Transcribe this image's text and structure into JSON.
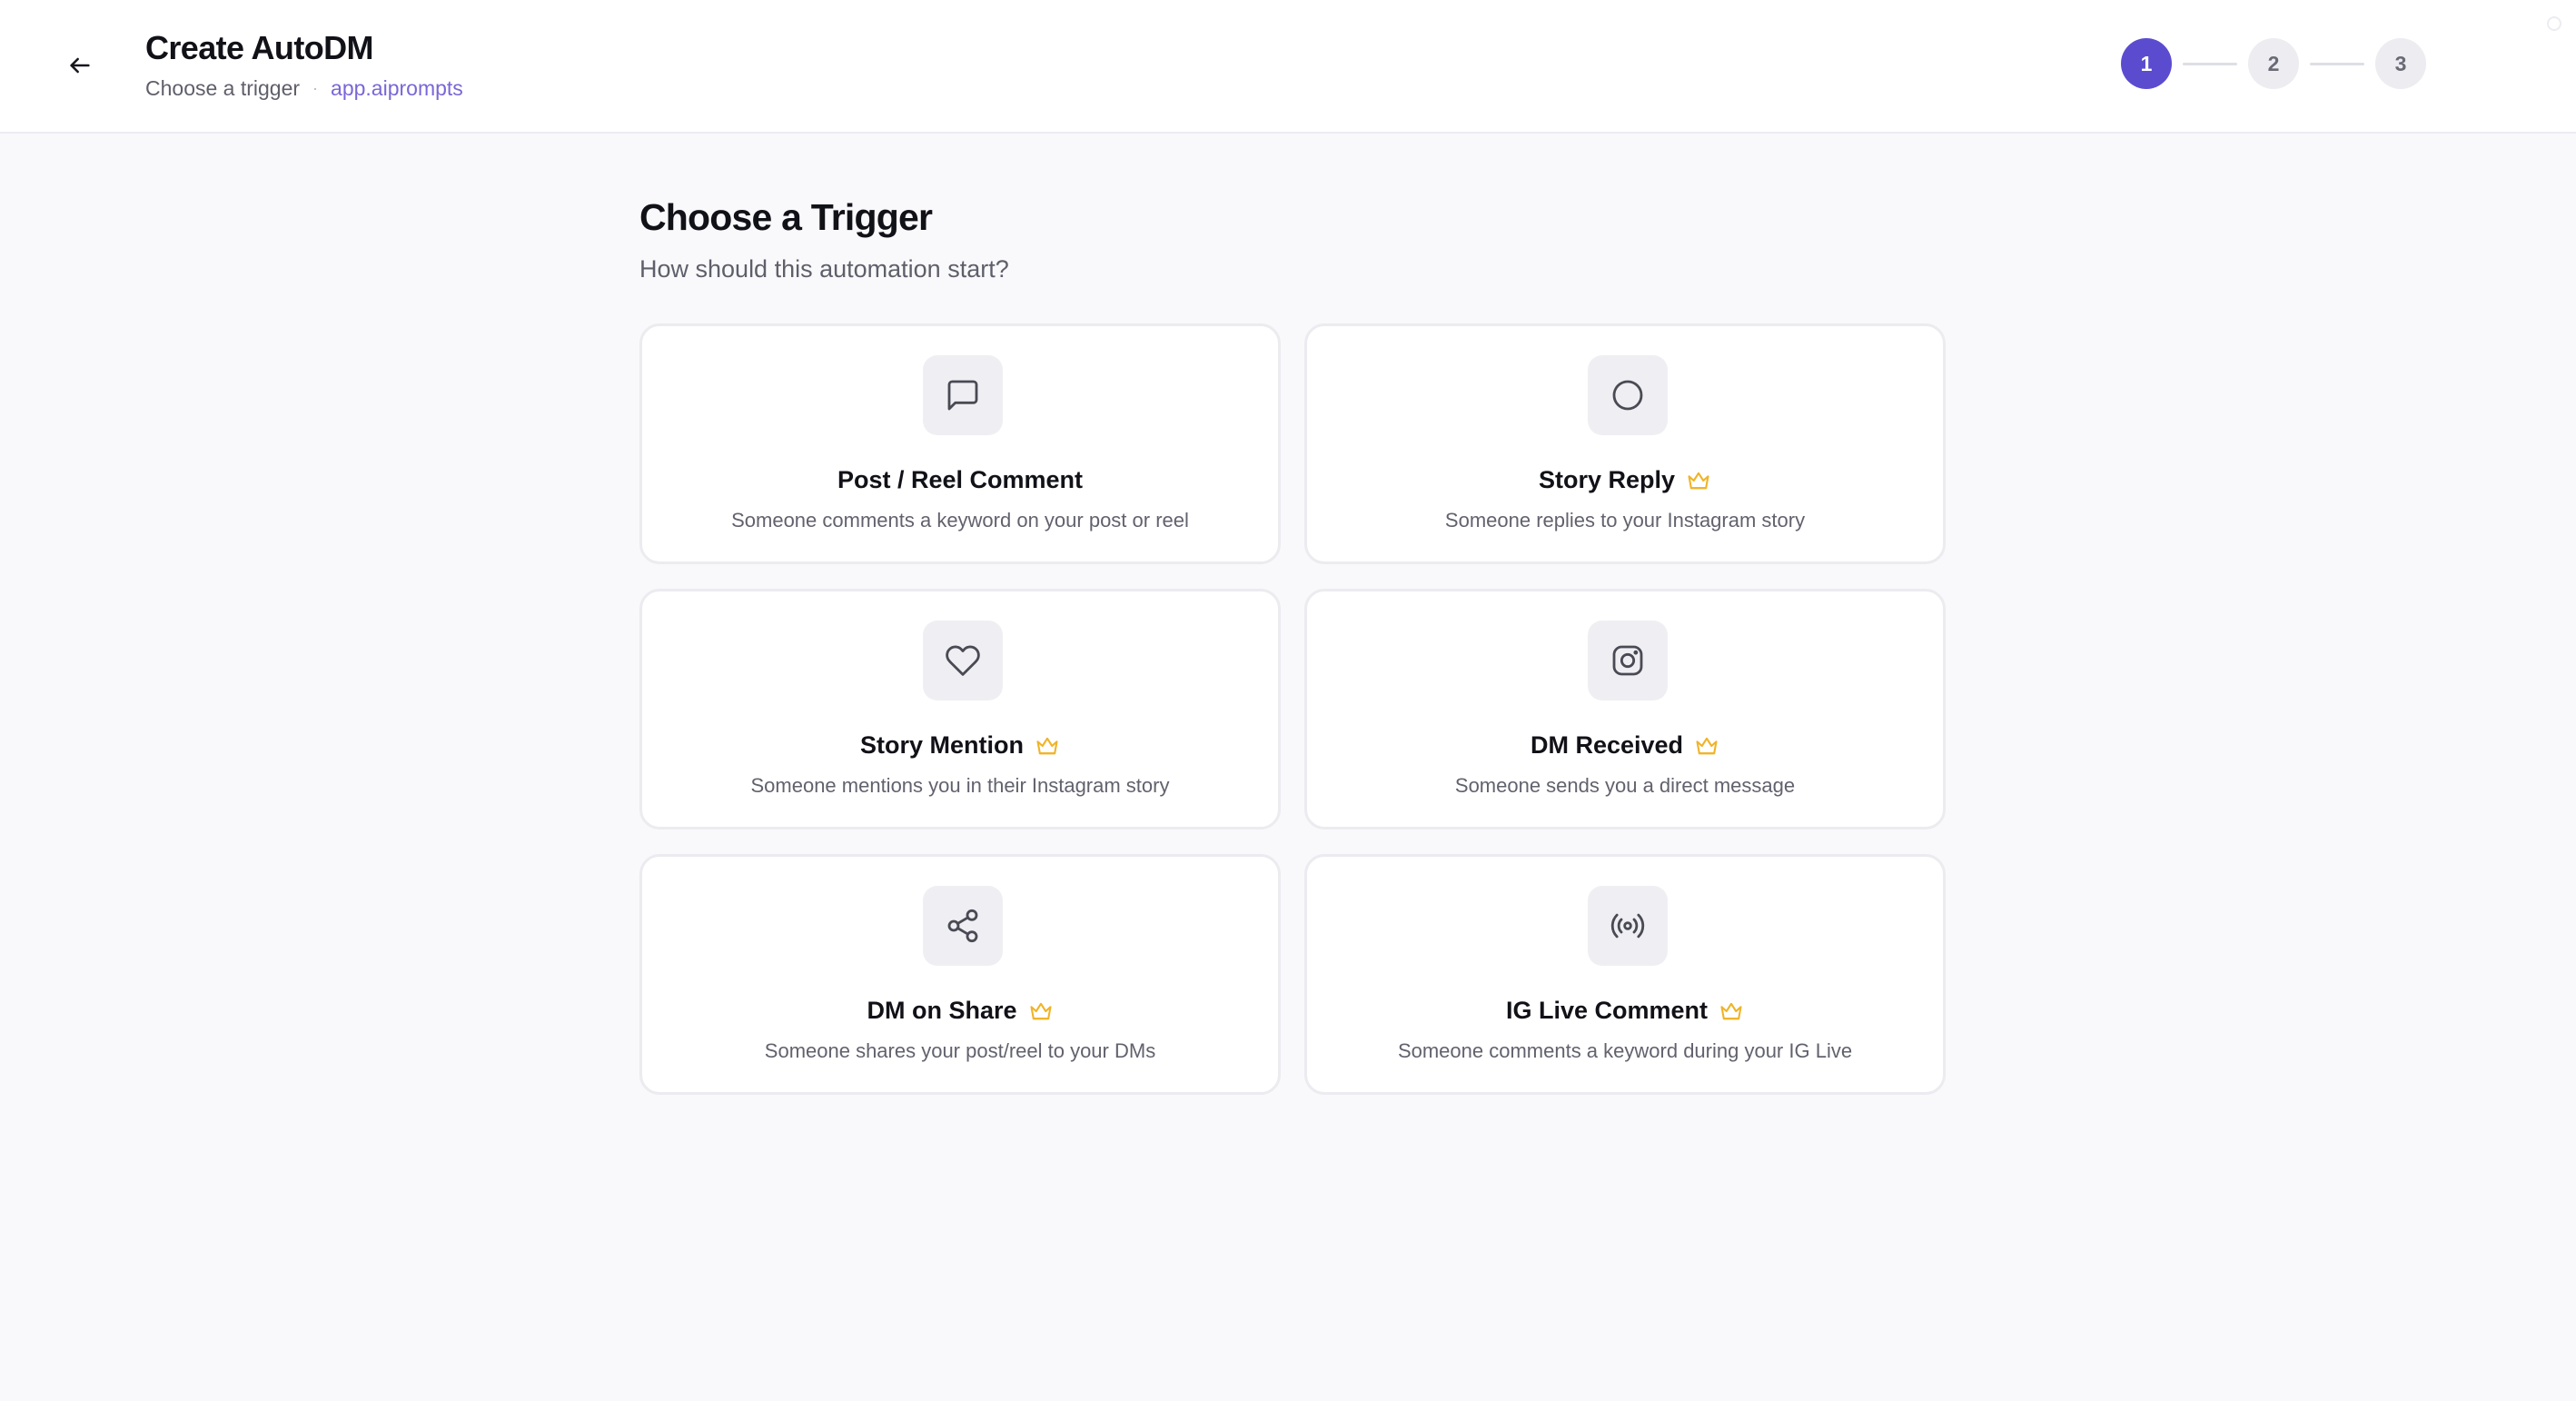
{
  "header": {
    "title": "Create AutoDM",
    "subtitle": "Choose a trigger",
    "separator": "·",
    "account": "app.aiprompts"
  },
  "stepper": {
    "steps": [
      "1",
      "2",
      "3"
    ],
    "active_step": "1"
  },
  "main": {
    "title": "Choose a Trigger",
    "subtitle": "How should this automation start?"
  },
  "triggers": [
    {
      "title": "Post / Reel Comment",
      "description": "Someone comments a keyword on your post or reel",
      "icon": "message-square-icon",
      "premium": false
    },
    {
      "title": "Story Reply",
      "description": "Someone replies to your Instagram story",
      "icon": "circle-icon",
      "premium": true
    },
    {
      "title": "Story Mention",
      "description": "Someone mentions you in their Instagram story",
      "icon": "heart-icon",
      "premium": true
    },
    {
      "title": "DM Received",
      "description": "Someone sends you a direct message",
      "icon": "instagram-icon",
      "premium": true
    },
    {
      "title": "DM on Share",
      "description": "Someone shares your post/reel to your DMs",
      "icon": "share-icon",
      "premium": true
    },
    {
      "title": "IG Live Comment",
      "description": "Someone comments a keyword during your IG Live",
      "icon": "radio-icon",
      "premium": true
    }
  ],
  "colors": {
    "accent": "#5b4ccf",
    "account_link": "#7a66d6",
    "crown": "#f0b429",
    "background": "#f9f9fb"
  }
}
